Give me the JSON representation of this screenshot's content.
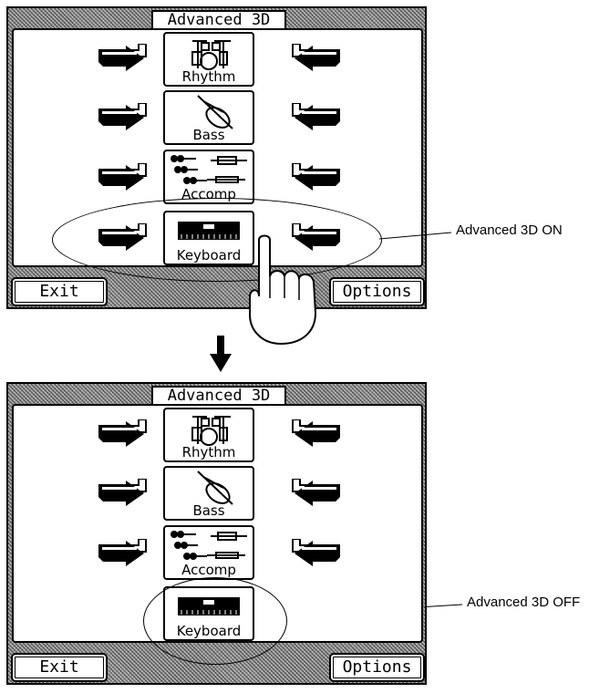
{
  "screens": [
    {
      "title": "Advanced 3D",
      "parts": [
        "Rhythm",
        "Bass",
        "Accomp",
        "Keyboard"
      ],
      "exit_label": "Exit",
      "options_label": "Options",
      "callout": "Advanced 3D ON",
      "keyboard_arrows": "on"
    },
    {
      "title": "Advanced 3D",
      "parts": [
        "Rhythm",
        "Bass",
        "Accomp",
        "Keyboard"
      ],
      "exit_label": "Exit",
      "options_label": "Options",
      "callout": "Advanced 3D OFF",
      "keyboard_arrows": "off"
    }
  ],
  "transition_icon": "down-arrow-icon",
  "pointer_icon": "pointing-hand-icon",
  "colors": {
    "ink": "#000000",
    "panel_pattern": "#9a9a9a",
    "screen": "#ffffff"
  }
}
